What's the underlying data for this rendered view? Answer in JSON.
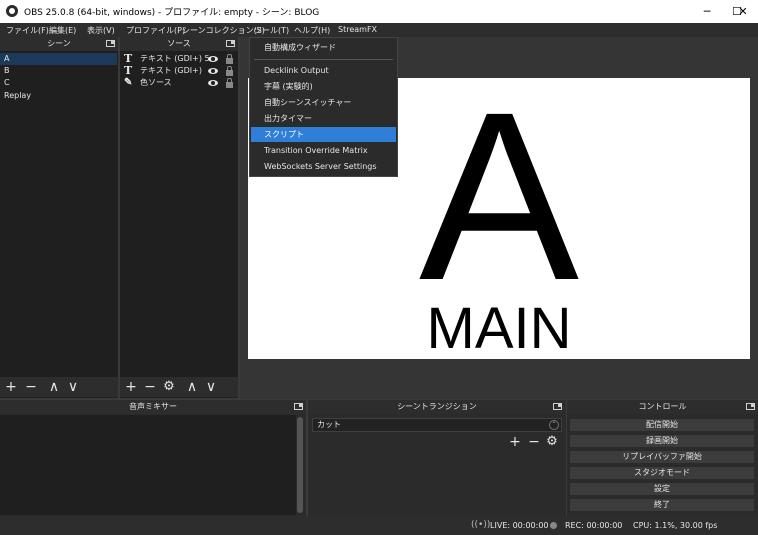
{
  "window": {
    "title": "OBS 25.0.8 (64-bit, windows) - プロファイル: empty - シーン: BLOG",
    "minimize": "─",
    "maximize": "☐",
    "close": "✕"
  },
  "menubar": {
    "items": [
      "ファイル(F)",
      "編集(E)",
      "表示(V)",
      "プロファイル(P)",
      "シーンコレクション(S)",
      "ツール(T)",
      "ヘルプ(H)",
      "StreamFX"
    ]
  },
  "tools_menu": {
    "items": [
      "自動構成ウィザード",
      "Decklink Output",
      "字幕 (実験的)",
      "自動シーンスイッチャー",
      "出力タイマー",
      "スクリプト",
      "Transition Override Matrix",
      "WebSockets Server Settings"
    ],
    "highlighted": "スクリプト"
  },
  "scenes": {
    "title": "シーン",
    "items": [
      "A",
      "B",
      "C",
      "Replay"
    ],
    "selected": "A"
  },
  "sources": {
    "title": "ソース",
    "items": [
      {
        "label": "テキスト (GDI+) 5",
        "icon": "text-icon"
      },
      {
        "label": "テキスト (GDI+)",
        "icon": "text-icon"
      },
      {
        "label": "色ソース",
        "icon": "brush-icon"
      }
    ]
  },
  "toolbar_glyphs": {
    "add": "+",
    "remove": "−",
    "up": "∧",
    "down": "∨",
    "gear": "⚙"
  },
  "preview": {
    "letter": "A",
    "caption": "MAIN"
  },
  "mixer": {
    "title": "音声ミキサー"
  },
  "transitions": {
    "title": "シーントランジション",
    "selected": "カット",
    "spinner": "⌃"
  },
  "controls": {
    "title": "コントロール",
    "buttons": [
      "配信開始",
      "録画開始",
      "リプレイバッファ開始",
      "スタジオモード",
      "設定",
      "終了"
    ]
  },
  "status": {
    "live": "LIVE: 00:00:00",
    "rec": "REC: 00:00:00",
    "cpu": "CPU: 1.1%, 30.00 fps"
  }
}
